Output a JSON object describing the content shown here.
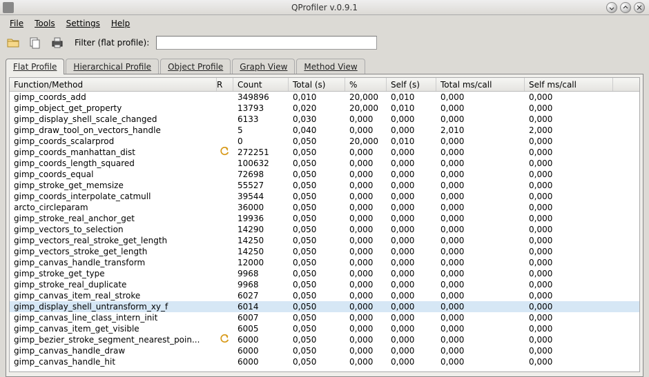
{
  "window": {
    "title": "QProfiler v.0.9.1"
  },
  "menu": {
    "file": "File",
    "tools": "Tools",
    "settings": "Settings",
    "help": "Help"
  },
  "toolbar": {
    "filter_label": "Filter (flat profile):",
    "filter_value": ""
  },
  "tabs": {
    "flat": "Flat Profile",
    "hier": "Hierarchical Profile",
    "obj": "Object Profile",
    "graph": "Graph View",
    "method": "Method View",
    "active": "flat"
  },
  "table": {
    "headers": {
      "fn": "Function/Method",
      "r": "R",
      "count": "Count",
      "total": "Total (s)",
      "pct": "%",
      "self": "Self (s)",
      "tmc": "Total ms/call",
      "smc": "Self ms/call"
    },
    "selected_index": 19,
    "rows": [
      {
        "fn": "gimp_coords_add",
        "r": "",
        "count": "349896",
        "total": "0,010",
        "pct": "20,000",
        "self": "0,010",
        "tmc": "0,000",
        "smc": "0,000"
      },
      {
        "fn": "gimp_object_get_property",
        "r": "",
        "count": "13793",
        "total": "0,020",
        "pct": "20,000",
        "self": "0,010",
        "tmc": "0,000",
        "smc": "0,000"
      },
      {
        "fn": "gimp_display_shell_scale_changed",
        "r": "",
        "count": "6133",
        "total": "0,030",
        "pct": "0,000",
        "self": "0,000",
        "tmc": "0,000",
        "smc": "0,000"
      },
      {
        "fn": "gimp_draw_tool_on_vectors_handle",
        "r": "",
        "count": "5",
        "total": "0,040",
        "pct": "0,000",
        "self": "0,000",
        "tmc": "2,010",
        "smc": "2,000"
      },
      {
        "fn": "gimp_coords_scalarprod",
        "r": "",
        "count": "0",
        "total": "0,050",
        "pct": "20,000",
        "self": "0,010",
        "tmc": "0,000",
        "smc": "0,000"
      },
      {
        "fn": "gimp_coords_manhattan_dist",
        "r": "arrow",
        "count": "272251",
        "total": "0,050",
        "pct": "0,000",
        "self": "0,000",
        "tmc": "0,000",
        "smc": "0,000"
      },
      {
        "fn": "gimp_coords_length_squared",
        "r": "",
        "count": "100632",
        "total": "0,050",
        "pct": "0,000",
        "self": "0,000",
        "tmc": "0,000",
        "smc": "0,000"
      },
      {
        "fn": "gimp_coords_equal",
        "r": "",
        "count": "72698",
        "total": "0,050",
        "pct": "0,000",
        "self": "0,000",
        "tmc": "0,000",
        "smc": "0,000"
      },
      {
        "fn": "gimp_stroke_get_memsize",
        "r": "",
        "count": "55527",
        "total": "0,050",
        "pct": "0,000",
        "self": "0,000",
        "tmc": "0,000",
        "smc": "0,000"
      },
      {
        "fn": "gimp_coords_interpolate_catmull",
        "r": "",
        "count": "39544",
        "total": "0,050",
        "pct": "0,000",
        "self": "0,000",
        "tmc": "0,000",
        "smc": "0,000"
      },
      {
        "fn": "arcto_circleparam",
        "r": "",
        "count": "36000",
        "total": "0,050",
        "pct": "0,000",
        "self": "0,000",
        "tmc": "0,000",
        "smc": "0,000"
      },
      {
        "fn": "gimp_stroke_real_anchor_get",
        "r": "",
        "count": "19936",
        "total": "0,050",
        "pct": "0,000",
        "self": "0,000",
        "tmc": "0,000",
        "smc": "0,000"
      },
      {
        "fn": "gimp_vectors_to_selection",
        "r": "",
        "count": "14290",
        "total": "0,050",
        "pct": "0,000",
        "self": "0,000",
        "tmc": "0,000",
        "smc": "0,000"
      },
      {
        "fn": "gimp_vectors_real_stroke_get_length",
        "r": "",
        "count": "14250",
        "total": "0,050",
        "pct": "0,000",
        "self": "0,000",
        "tmc": "0,000",
        "smc": "0,000"
      },
      {
        "fn": "gimp_vectors_stroke_get_length",
        "r": "",
        "count": "14250",
        "total": "0,050",
        "pct": "0,000",
        "self": "0,000",
        "tmc": "0,000",
        "smc": "0,000"
      },
      {
        "fn": "gimp_canvas_handle_transform",
        "r": "",
        "count": "12000",
        "total": "0,050",
        "pct": "0,000",
        "self": "0,000",
        "tmc": "0,000",
        "smc": "0,000"
      },
      {
        "fn": "gimp_stroke_get_type",
        "r": "",
        "count": "9968",
        "total": "0,050",
        "pct": "0,000",
        "self": "0,000",
        "tmc": "0,000",
        "smc": "0,000"
      },
      {
        "fn": "gimp_stroke_real_duplicate",
        "r": "",
        "count": "9968",
        "total": "0,050",
        "pct": "0,000",
        "self": "0,000",
        "tmc": "0,000",
        "smc": "0,000"
      },
      {
        "fn": "gimp_canvas_item_real_stroke",
        "r": "",
        "count": "6027",
        "total": "0,050",
        "pct": "0,000",
        "self": "0,000",
        "tmc": "0,000",
        "smc": "0,000"
      },
      {
        "fn": "gimp_display_shell_untransform_xy_f",
        "r": "",
        "count": "6014",
        "total": "0,050",
        "pct": "0,000",
        "self": "0,000",
        "tmc": "0,000",
        "smc": "0,000"
      },
      {
        "fn": "gimp_canvas_line_class_intern_init",
        "r": "",
        "count": "6007",
        "total": "0,050",
        "pct": "0,000",
        "self": "0,000",
        "tmc": "0,000",
        "smc": "0,000"
      },
      {
        "fn": "gimp_canvas_item_get_visible",
        "r": "",
        "count": "6005",
        "total": "0,050",
        "pct": "0,000",
        "self": "0,000",
        "tmc": "0,000",
        "smc": "0,000"
      },
      {
        "fn": "gimp_bezier_stroke_segment_nearest_poin...",
        "r": "arrow",
        "count": "6000",
        "total": "0,050",
        "pct": "0,000",
        "self": "0,000",
        "tmc": "0,000",
        "smc": "0,000"
      },
      {
        "fn": "gimp_canvas_handle_draw",
        "r": "",
        "count": "6000",
        "total": "0,050",
        "pct": "0,000",
        "self": "0,000",
        "tmc": "0,000",
        "smc": "0,000"
      },
      {
        "fn": "gimp_canvas_handle_hit",
        "r": "",
        "count": "6000",
        "total": "0,050",
        "pct": "0,000",
        "self": "0,000",
        "tmc": "0,000",
        "smc": "0,000"
      }
    ]
  }
}
